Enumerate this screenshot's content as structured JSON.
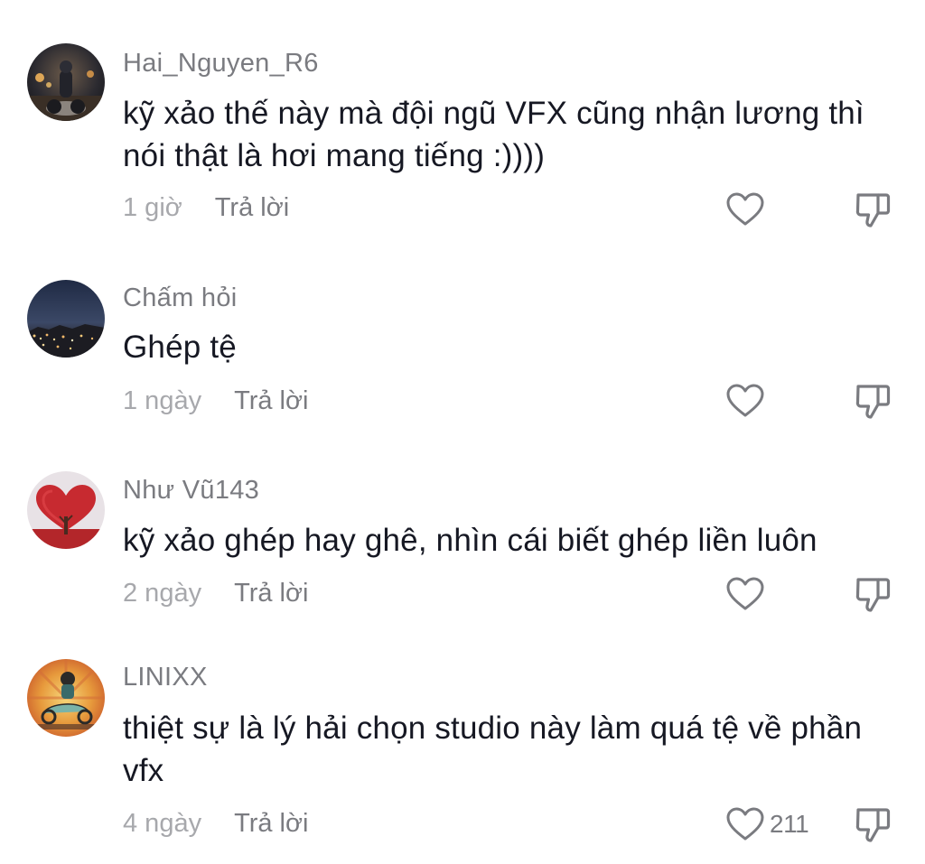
{
  "comments": [
    {
      "username": "Hai_Nguyen_R6",
      "text": "kỹ xảo thế này mà đội ngũ VFX cũng nhận lương thì nói thật là hơi mang tiếng :))))",
      "time": "1 giờ",
      "reply_label": "Trả lời",
      "like_count": "",
      "avatar_icon": "motorcycle-night-avatar"
    },
    {
      "username": "Chấm hỏi",
      "text": "Ghép tệ",
      "time": "1 ngày",
      "reply_label": "Trả lời",
      "like_count": "",
      "avatar_icon": "night-city-avatar"
    },
    {
      "username": "Như Vũ143",
      "text": "kỹ xảo ghép hay ghê, nhìn cái biết ghép liền luôn",
      "time": "2 ngày",
      "reply_label": "Trả lời",
      "like_count": "",
      "avatar_icon": "heart-tree-avatar"
    },
    {
      "username": "LINIXX",
      "text": "thiệt sự là lý hải chọn studio này làm quá tệ về phần vfx",
      "time": "4 ngày",
      "reply_label": "Trả lời",
      "like_count": "211",
      "avatar_icon": "retro-scooter-avatar"
    }
  ],
  "icons": {
    "like": "heart-outline-icon",
    "dislike": "thumbs-down-outline-icon"
  },
  "colors": {
    "text_primary": "#161823",
    "text_secondary": "#7a7b80",
    "text_tertiary": "#a7a8ac",
    "background": "#ffffff"
  }
}
